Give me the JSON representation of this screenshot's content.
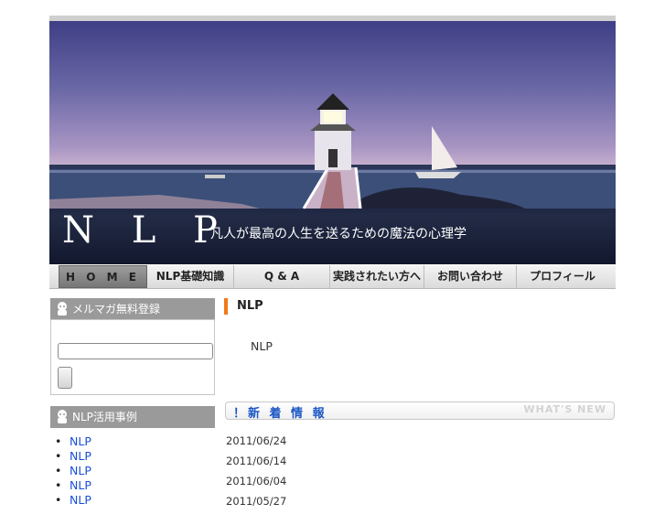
{
  "header": {
    "logo": "N L P",
    "tagline": "凡人が最高の人生を送るための魔法の心理学"
  },
  "nav": [
    {
      "label": "H O M E",
      "active": true
    },
    {
      "label": "NLP基礎知識"
    },
    {
      "label": "Q & A"
    },
    {
      "label": "実践されたい方へ"
    },
    {
      "label": "お問い合わせ"
    },
    {
      "label": "プロフィール"
    }
  ],
  "sidebar": {
    "newsletter_title": "メルマガ無料登録",
    "cases_title": "NLP活用事例",
    "cases": [
      "NLP",
      "NLP",
      "NLP",
      "NLP",
      "NLP"
    ]
  },
  "main": {
    "title": "NLP",
    "body": "NLP"
  },
  "news": {
    "title": "！新 着 情 報",
    "subtitle": "WHAT'S NEW",
    "dates": [
      "2011/06/24",
      "2011/06/14",
      "2011/06/04",
      "2011/05/27"
    ]
  },
  "colors": {
    "accent_orange": "#f07a1a",
    "link_blue": "#1a4fd6",
    "sidebar_gray": "#9a9a9a"
  }
}
